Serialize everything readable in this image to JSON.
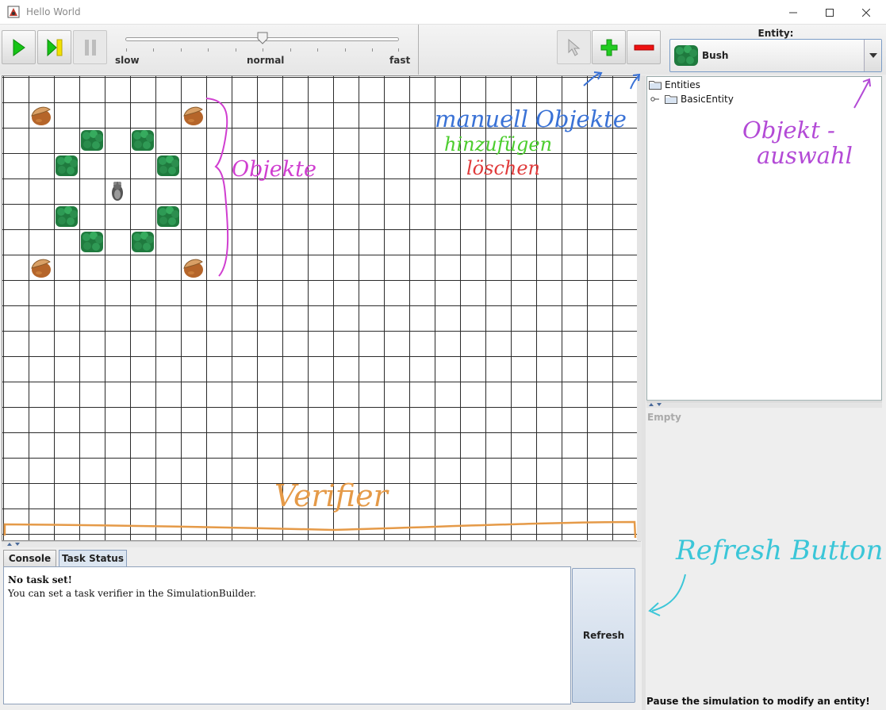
{
  "window": {
    "title": "Hello World"
  },
  "toolbar": {
    "play_icon": "play-icon",
    "step_icon": "step-forward-icon",
    "pause_icon": "pause-icon",
    "speed": {
      "slow_label": "slow",
      "normal_label": "normal",
      "fast_label": "fast",
      "value_fraction": 0.5
    },
    "select_icon": "cursor-arrow-icon",
    "add_icon": "plus-icon",
    "remove_icon": "minus-icon",
    "entity_label": "Entity:",
    "entity_value": "Bush"
  },
  "world": {
    "grid_cols": 25,
    "grid_rows": 18,
    "entities": [
      {
        "type": "acorn",
        "col": 1,
        "row": 1
      },
      {
        "type": "acorn",
        "col": 7,
        "row": 1
      },
      {
        "type": "bush",
        "col": 3,
        "row": 2
      },
      {
        "type": "bush",
        "col": 5,
        "row": 2
      },
      {
        "type": "bush",
        "col": 2,
        "row": 3
      },
      {
        "type": "bush",
        "col": 6,
        "row": 3
      },
      {
        "type": "hamster",
        "col": 4,
        "row": 4
      },
      {
        "type": "bush",
        "col": 2,
        "row": 5
      },
      {
        "type": "bush",
        "col": 6,
        "row": 5
      },
      {
        "type": "bush",
        "col": 3,
        "row": 6
      },
      {
        "type": "bush",
        "col": 5,
        "row": 6
      },
      {
        "type": "acorn",
        "col": 1,
        "row": 7
      },
      {
        "type": "acorn",
        "col": 7,
        "row": 7
      }
    ]
  },
  "annotations": {
    "objects": "Objekte",
    "manual_line1": "manuell Objekte",
    "manual_line2": "hinzufügen",
    "manual_line3": "löschen",
    "verifier": "Verifier",
    "object_selection_line1": "Objekt -",
    "object_selection_line2": "auswahl",
    "refresh_note": "Refresh Button",
    "colors": {
      "magenta": "#d03ed0",
      "blue": "#3a72d6",
      "green": "#4ccd2e",
      "red": "#e03a3a",
      "orange": "#e59a48",
      "purple": "#b34ad6",
      "cyan": "#3bc6d8"
    }
  },
  "bottom": {
    "tabs": [
      "Console",
      "Task Status"
    ],
    "active_tab": "Task Status",
    "task_title": "No task set!",
    "task_message": "You can set a task verifier in the SimulationBuilder.",
    "refresh_label": "Refresh"
  },
  "side": {
    "tree_root": "Entities",
    "tree_child": "BasicEntity",
    "empty_label": "Empty",
    "pause_message": "Pause the simulation to modify an entity!"
  }
}
